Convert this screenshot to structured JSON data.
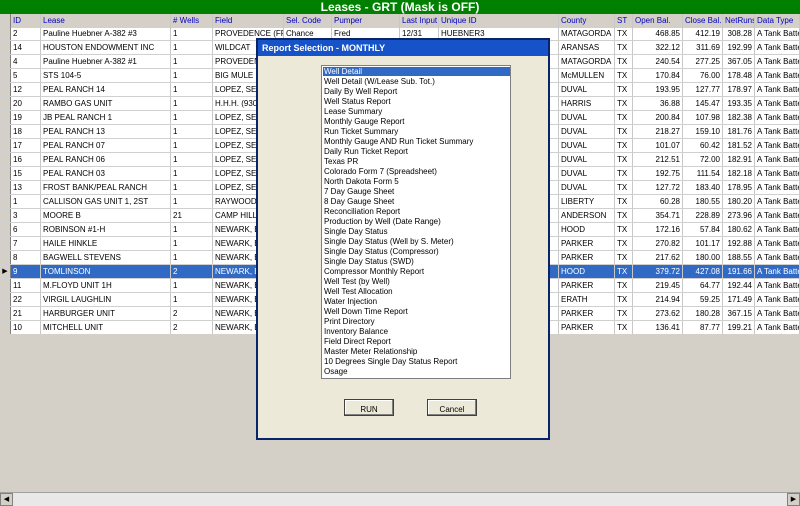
{
  "window_title": "Leases - GRT (Mask is OFF)",
  "columns": [
    "ID",
    "Lease",
    "# Wells",
    "Field",
    "Sel. Code",
    "Pumper",
    "Last Input",
    "Unique ID",
    "County",
    "ST",
    "Open Bal.",
    "Close Bal.",
    "NetRuns",
    "Data Type"
  ],
  "rows": [
    [
      "2",
      "Pauline Huebner A-382 #3",
      "1",
      "PROVEDENCE (FRIO",
      "Chance",
      "Fred",
      "12/31",
      "HUEBNER3",
      "MATAGORDA",
      "TX",
      "468.85",
      "412.19",
      "308.28",
      "A Tank Batte"
    ],
    [
      "14",
      "HOUSTON ENDOWMENT INC",
      "1",
      "WILDCAT",
      "",
      "",
      "",
      "",
      "ARANSAS",
      "TX",
      "322.12",
      "311.69",
      "192.99",
      "A Tank Batte"
    ],
    [
      "4",
      "Pauline Huebner A-382 #1",
      "1",
      "PROVEDENCE",
      "",
      "",
      "",
      "",
      "MATAGORDA",
      "TX",
      "240.54",
      "277.25",
      "367.05",
      "A Tank Batte"
    ],
    [
      "5",
      "STS 104-5",
      "1",
      "BIG MULE (C",
      "",
      "",
      "",
      "",
      "McMULLEN",
      "TX",
      "170.84",
      "76.00",
      "178.48",
      "A Tank Batte"
    ],
    [
      "12",
      "PEAL RANCH 14",
      "1",
      "LOPEZ, SE.",
      "",
      "",
      "",
      "",
      "DUVAL",
      "TX",
      "193.95",
      "127.77",
      "178.97",
      "A Tank Batte"
    ],
    [
      "20",
      "RAMBO GAS UNIT",
      "1",
      "H.H.H. (9300",
      "",
      "",
      "",
      "",
      "HARRIS",
      "TX",
      "36.88",
      "145.47",
      "193.35",
      "A Tank Batte"
    ],
    [
      "19",
      "JB PEAL RANCH 1",
      "1",
      "LOPEZ, SE.",
      "",
      "",
      "",
      "",
      "DUVAL",
      "TX",
      "200.84",
      "107.98",
      "182.38",
      "A Tank Batte"
    ],
    [
      "18",
      "PEAL RANCH 13",
      "1",
      "LOPEZ, SE.",
      "",
      "",
      "",
      "",
      "DUVAL",
      "TX",
      "218.27",
      "159.10",
      "181.76",
      "A Tank Batte"
    ],
    [
      "17",
      "PEAL RANCH 07",
      "1",
      "LOPEZ, SE.",
      "",
      "",
      "",
      "",
      "DUVAL",
      "TX",
      "101.07",
      "60.42",
      "181.52",
      "A Tank Batte"
    ],
    [
      "16",
      "PEAL RANCH 06",
      "1",
      "LOPEZ, SE.",
      "",
      "",
      "",
      "",
      "DUVAL",
      "TX",
      "212.51",
      "72.00",
      "182.91",
      "A Tank Batte"
    ],
    [
      "15",
      "PEAL RANCH 03",
      "1",
      "LOPEZ, SE.",
      "",
      "",
      "",
      "",
      "DUVAL",
      "TX",
      "192.75",
      "111.54",
      "182.18",
      "A Tank Batte"
    ],
    [
      "13",
      "FROST BANK/PEAL RANCH",
      "1",
      "LOPEZ, SE.",
      "",
      "",
      "",
      "",
      "DUVAL",
      "TX",
      "127.72",
      "183.40",
      "178.95",
      "A Tank Batte"
    ],
    [
      "1",
      "CALLISON GAS UNIT 1, 2ST",
      "1",
      "RAYWOOD",
      "",
      "",
      "",
      "",
      "LIBERTY",
      "TX",
      "60.28",
      "180.55",
      "180.20",
      "A Tank Batte"
    ],
    [
      "3",
      "MOORE B",
      "21",
      "CAMP HILL",
      "",
      "",
      "",
      "",
      "ANDERSON",
      "TX",
      "354.71",
      "228.89",
      "273.96",
      "A Tank Batte"
    ],
    [
      "6",
      "ROBINSON #1-H",
      "1",
      "NEWARK, E",
      "",
      "",
      "",
      "",
      "HOOD",
      "TX",
      "172.16",
      "57.84",
      "180.62",
      "A Tank Batte"
    ],
    [
      "7",
      "HAILE HINKLE",
      "1",
      "NEWARK, E",
      "",
      "",
      "",
      "",
      "PARKER",
      "TX",
      "270.82",
      "101.17",
      "192.88",
      "A Tank Batte"
    ],
    [
      "8",
      "BAGWELL STEVENS",
      "1",
      "NEWARK, E",
      "",
      "",
      "",
      "",
      "PARKER",
      "TX",
      "217.62",
      "180.00",
      "188.55",
      "A Tank Batte"
    ],
    [
      "9",
      "TOMLINSON",
      "2",
      "NEWARK, E",
      "",
      "",
      "",
      "",
      "HOOD",
      "TX",
      "379.72",
      "427.08",
      "191.66",
      "A Tank Batte"
    ],
    [
      "11",
      "M.FLOYD UNIT 1H",
      "1",
      "NEWARK, E",
      "",
      "",
      "",
      "",
      "PARKER",
      "TX",
      "219.45",
      "64.77",
      "192.44",
      "A Tank Batte"
    ],
    [
      "22",
      "VIRGIL LAUGHLIN",
      "1",
      "NEWARK, E",
      "",
      "",
      "",
      "",
      "ERATH",
      "TX",
      "214.94",
      "59.25",
      "171.49",
      "A Tank Batte"
    ],
    [
      "21",
      "HARBURGER UNIT",
      "2",
      "NEWARK, E",
      "",
      "",
      "",
      "",
      "PARKER",
      "TX",
      "273.62",
      "180.28",
      "367.15",
      "A Tank Batte"
    ],
    [
      "10",
      "MITCHELL UNIT",
      "2",
      "NEWARK, E",
      "",
      "",
      "",
      "",
      "PARKER",
      "TX",
      "136.41",
      "87.77",
      "199.21",
      "A Tank Batte"
    ]
  ],
  "selected_row": 17,
  "dialog": {
    "title": "Report Selection - MONTHLY",
    "items": [
      "Well Detail",
      "Well Detail (W/Lease Sub. Tot.)",
      "Daily By Well Report",
      "Well Status Report",
      "Lease Summary",
      "Monthly Gauge Report",
      "Run Ticket Summary",
      "Monthly Gauge AND Run Ticket Summary",
      "Daily Run Ticket Report",
      "Texas PR",
      "Colorado Form 7 (Spreadsheet)",
      "North Dakota Form 5",
      "7 Day Gauge Sheet",
      "8 Day Gauge Sheet",
      "Reconciliation Report",
      "Production by Well (Date Range)",
      "Single Day Status",
      "Single Day Status (Well by S. Meter)",
      "Single Day Status (Compressor)",
      "Single Day Status (SWD)",
      "Compressor Monthly Report",
      "Well Test (by Well)",
      "Well Test Allocation",
      "Water Injection",
      "Well Down Time Report",
      "Print Directory",
      "Inventory Balance",
      "Field Direct Report",
      "Master Meter Relationship",
      "10 Degrees Single Day Status Report",
      "Osage"
    ],
    "selected_index": 0,
    "run_label": "RUN",
    "cancel_label": "Cancel"
  },
  "icons": {
    "row_pointer": "row-pointer-icon",
    "scroll_left": "arrow-left-icon",
    "scroll_right": "arrow-right-icon"
  }
}
